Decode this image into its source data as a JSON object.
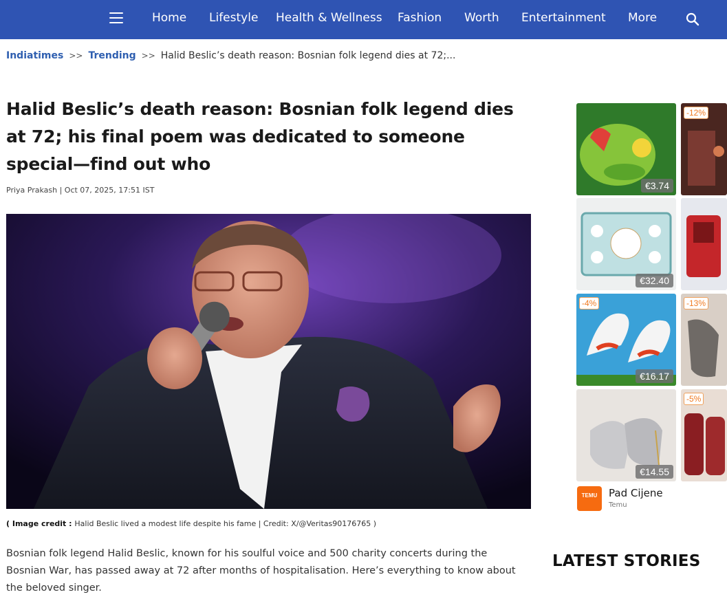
{
  "nav": {
    "items": [
      "Home",
      "Lifestyle",
      "Health & Wellness",
      "Fashion",
      "Worth",
      "Entertainment",
      "More"
    ],
    "bg_color": "#2f54b3",
    "menu_icon": "hamburger-icon",
    "search_icon": "search-icon"
  },
  "breadcrumb": {
    "home": "Indiatimes",
    "sep1": ">>",
    "section": "Trending",
    "sep2": ">>",
    "current": "Halid Beslic’s death reason: Bosnian folk legend dies at 72;..."
  },
  "article": {
    "headline": "Halid Beslic’s death reason: Bosnian folk legend dies at 72; his final poem was dedicated to someone special—find out who",
    "byline": "Priya Prakash | Oct 07, 2025, 17:51 IST",
    "caption_label": "( Image credit : ",
    "caption_text": "Halid Beslic lived a modest life despite his fame | Credit: X/@Veritas90176765 )",
    "lede": "Bosnian folk legend Halid Beslic, known for his soulful voice and 500 charity concerts during the Bosnian War, has passed away at 72 after months of hospitalisation. Here’s everything to know about the beloved singer."
  },
  "ad": {
    "tiles": [
      {
        "price": "€3.74",
        "discount": ""
      },
      {
        "price": "",
        "discount": "-12%"
      },
      {
        "price": "€32.40",
        "discount": ""
      },
      {
        "price": "",
        "discount": ""
      },
      {
        "price": "€16.17",
        "discount": "-4%"
      },
      {
        "price": "",
        "discount": "-13%"
      },
      {
        "price": "€14.55",
        "discount": ""
      },
      {
        "price": "",
        "discount": "-5%"
      }
    ],
    "brand_logo_text": "TEMU",
    "title": "Pad Cijene",
    "subtitle": "Temu"
  },
  "sidebar": {
    "latest_title": "LATEST STORIES"
  }
}
